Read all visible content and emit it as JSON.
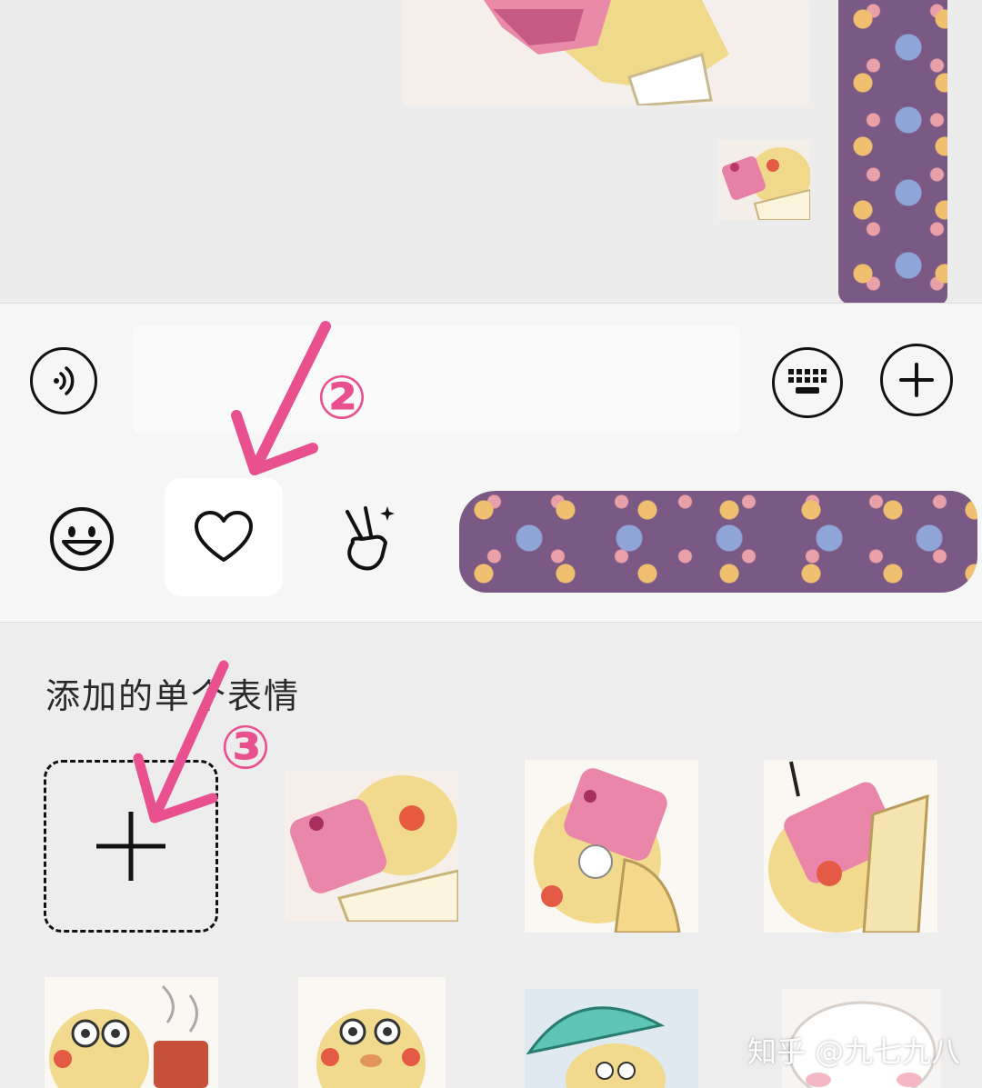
{
  "input_bar": {
    "voice_icon": "voice-input-icon",
    "keyboard_icon": "keyboard-icon",
    "more_icon": "plus-circle-icon"
  },
  "tabs": [
    {
      "icon": "smiley-face-icon",
      "active": false
    },
    {
      "icon": "heart-icon",
      "active": true
    },
    {
      "icon": "victory-hand-sparkle-icon",
      "active": false
    }
  ],
  "panel": {
    "title": "添加的单个表情",
    "add_icon": "plus-icon"
  },
  "annotations": {
    "step2": "②",
    "step3": "③"
  },
  "watermark": "知乎 @九七九八",
  "colors": {
    "annotation": "#e8508f",
    "redaction": "#7a5a85"
  }
}
